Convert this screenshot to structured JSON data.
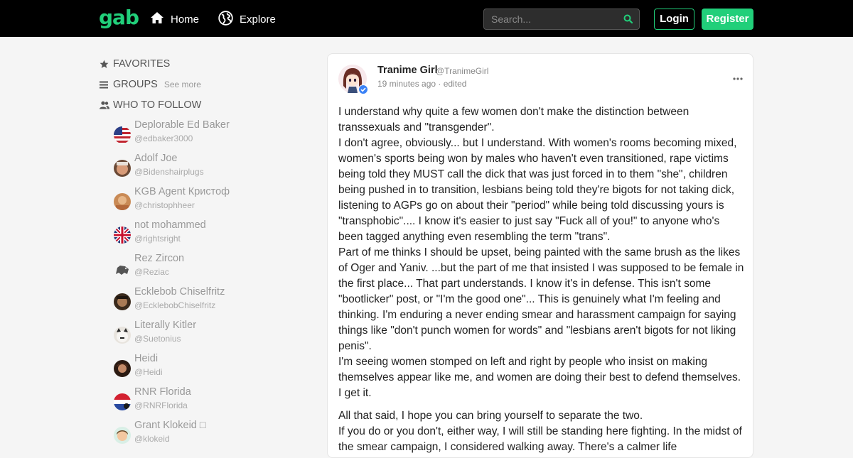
{
  "brand": {
    "logo": "gab",
    "accent": "#21cf7a"
  },
  "nav": {
    "home": "Home",
    "explore": "Explore"
  },
  "search": {
    "placeholder": "Search..."
  },
  "auth": {
    "login": "Login",
    "register": "Register"
  },
  "sidebar": {
    "favorites": "FAVORITES",
    "groups": "GROUPS",
    "see_more": "See more",
    "who_to_follow": "WHO TO FOLLOW",
    "follow": [
      {
        "name": "Deplorable Ed Baker",
        "handle": "@edbaker3000"
      },
      {
        "name": "Adolf Joe",
        "handle": "@Bidenshairplugs"
      },
      {
        "name": "KGB Agent Кристоф",
        "handle": "@christophheer"
      },
      {
        "name": "not mohammed",
        "handle": "@rightsright"
      },
      {
        "name": "Rez Zircon",
        "handle": "@Reziac"
      },
      {
        "name": "Ecklebob Chiselfritz",
        "handle": "@EcklebobChiselfritz"
      },
      {
        "name": "Literally Kitler",
        "handle": "@Suetonius"
      },
      {
        "name": "Heidi",
        "handle": "@Heidi"
      },
      {
        "name": "RNR Florida",
        "handle": "@RNRFlorida"
      },
      {
        "name": "Grant Klokeid □",
        "handle": "@klokeid"
      }
    ]
  },
  "post": {
    "author": "Tranime Girl",
    "handle": "@TranimeGirl",
    "meta": "19 minutes ago · edited",
    "paragraphs": [
      "I understand why quite a few women don't make the distinction between transsexuals and \"transgender\".\nI don't agree, obviously... but I understand. With women's rooms becoming mixed, women's sports being won by males who haven't even transitioned, rape victims being told they MUST call the dick that was just forced in to them \"she\", children being pushed in to transition, lesbians being told they're bigots for not taking dick, listening to AGPs go on about their \"period\" while being told discussing yours is \"transphobic\".... I know it's easier to just say \"Fuck all of you!\" to anyone who's been tagged anything even resembling the term \"trans\".\nPart of me thinks I should be upset, being painted with the same brush as the likes of Oger and Yaniv. ...but the part of me that insisted I was supposed to be female in the first place... That part understands. I know it's in defense. This isn't some \"bootlicker\" post, or \"I'm the good one\"... This is genuinely what I'm feeling and thinking. I'm enduring a never ending smear and harassment campaign for saying things like \"don't punch women for words\" and \"lesbians aren't bigots for not liking penis\".\nI'm seeing women stomped on left and right by people who insist on making themselves appear like me, and women are doing their best to defend themselves. I get it.",
      "All that said, I hope you can bring yourself to separate the two.\nIf you do or you don't, either way, I will still be standing here fighting. In the midst of the smear campaign, I considered walking away. There's a calmer life"
    ]
  }
}
